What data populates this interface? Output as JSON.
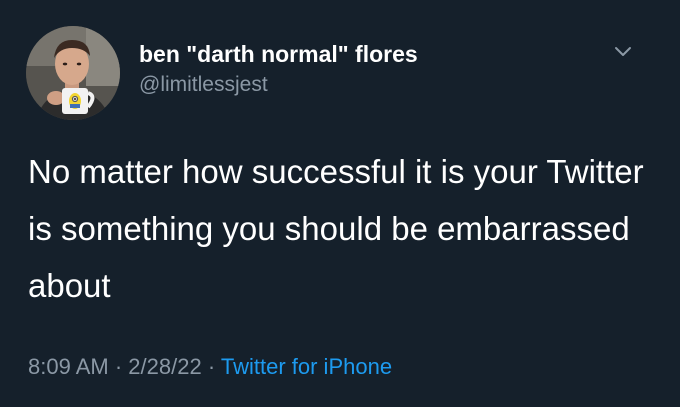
{
  "author": {
    "display_name": "ben \"darth normal\" flores",
    "handle": "@limitlessjest"
  },
  "tweet": {
    "text": "No matter how successful it is your Twitter is something you should be embarrassed about",
    "time": "8:09 AM",
    "separator": "·",
    "date": "2/28/22",
    "source": "Twitter for iPhone"
  },
  "icons": {
    "menu": "chevron-down-icon"
  },
  "colors": {
    "background": "#15202b",
    "text_primary": "#ffffff",
    "text_secondary": "#8b98a5",
    "link": "#1d9bf0"
  }
}
